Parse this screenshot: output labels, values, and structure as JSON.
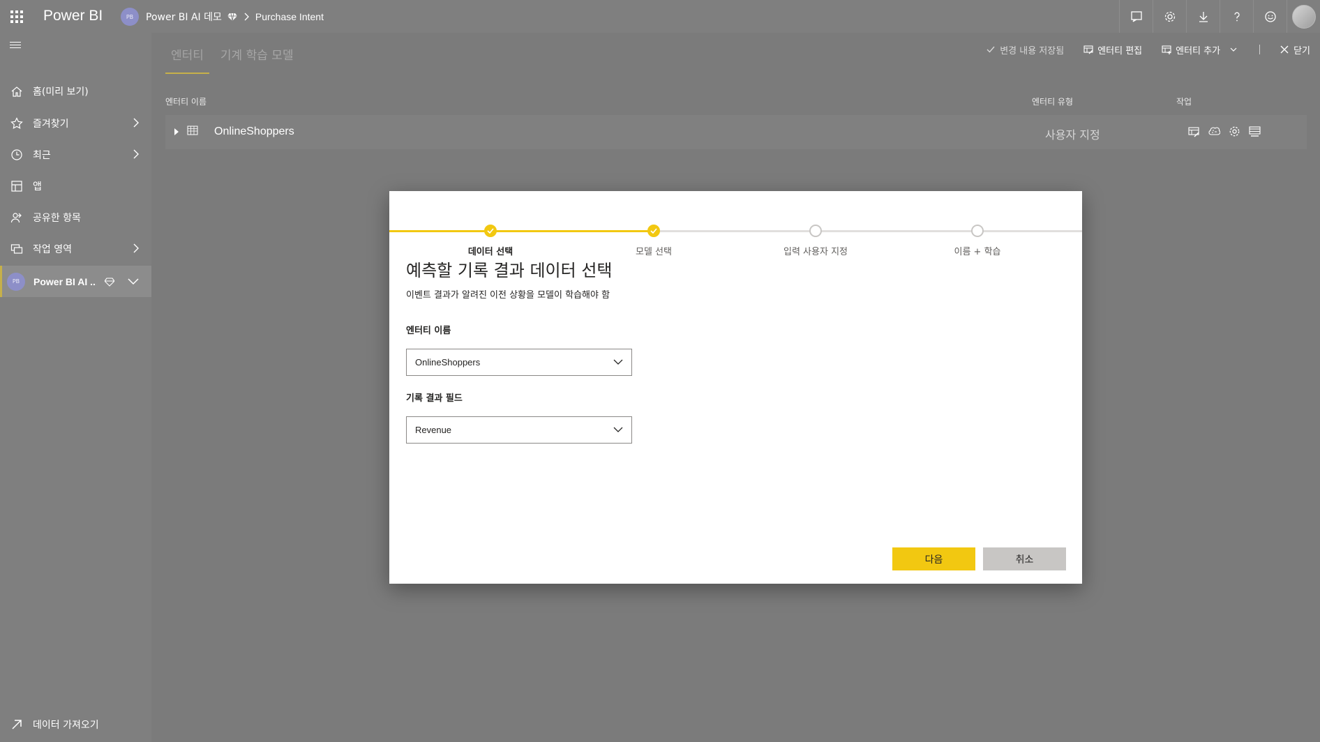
{
  "app": {
    "brand": "Power BI",
    "workspace_initials": "PB",
    "workspace_name": "Power BI AI 데모",
    "current_item": "Purchase Intent"
  },
  "top_icons": [
    "notifications-icon",
    "settings-icon",
    "download-icon",
    "help-icon",
    "feedback-icon",
    "user-avatar"
  ],
  "sidebar": {
    "items": [
      {
        "label": "홈(미리 보기)",
        "icon": "home-icon"
      },
      {
        "label": "즐겨찾기",
        "icon": "star-icon"
      },
      {
        "label": "최근",
        "icon": "clock-icon"
      },
      {
        "label": "앱",
        "icon": "apps-icon"
      },
      {
        "label": "공유한 항목",
        "icon": "shared-icon"
      },
      {
        "label": "작업 영역",
        "icon": "workspaces-icon"
      }
    ],
    "active_workspace": {
      "initials": "PB",
      "label": "Power BI AI ..."
    },
    "get_data": "데이터 가져오기"
  },
  "tabs": [
    {
      "label": "엔터티"
    },
    {
      "label": "기계 학습 모델"
    }
  ],
  "commands": {
    "saved": "변경 내용 저장됨",
    "edit_entities": "엔터티 편집",
    "add_entities": "엔터티 추가",
    "close": "닫기"
  },
  "table": {
    "headers": {
      "name": "엔터티 이름",
      "type": "엔터티 유형",
      "actions": "작업"
    },
    "rows": [
      {
        "name": "OnlineShoppers",
        "type": "사용자 지정"
      }
    ]
  },
  "dialog": {
    "steps": [
      {
        "label": "데이터 선택",
        "state": "done"
      },
      {
        "label": "모델 선택",
        "state": "done"
      },
      {
        "label": "입력 사용자 지정",
        "state": "todo"
      },
      {
        "label": "이름 + 학습",
        "state": "todo"
      }
    ],
    "title": "예측할 기록 결과 데이터 선택",
    "subtitle": "이벤트 결과가 알려진 이전 상황을 모델이 학습해야 함",
    "entity_label": "엔터티 이름",
    "entity_value": "OnlineShoppers",
    "outcome_label": "기록 결과 필드",
    "outcome_value": "Revenue",
    "next": "다음",
    "cancel": "취소"
  },
  "colors": {
    "accent": "#f2c811",
    "overlay": "#7f7f7f",
    "button_secondary": "#c8c6c4"
  }
}
